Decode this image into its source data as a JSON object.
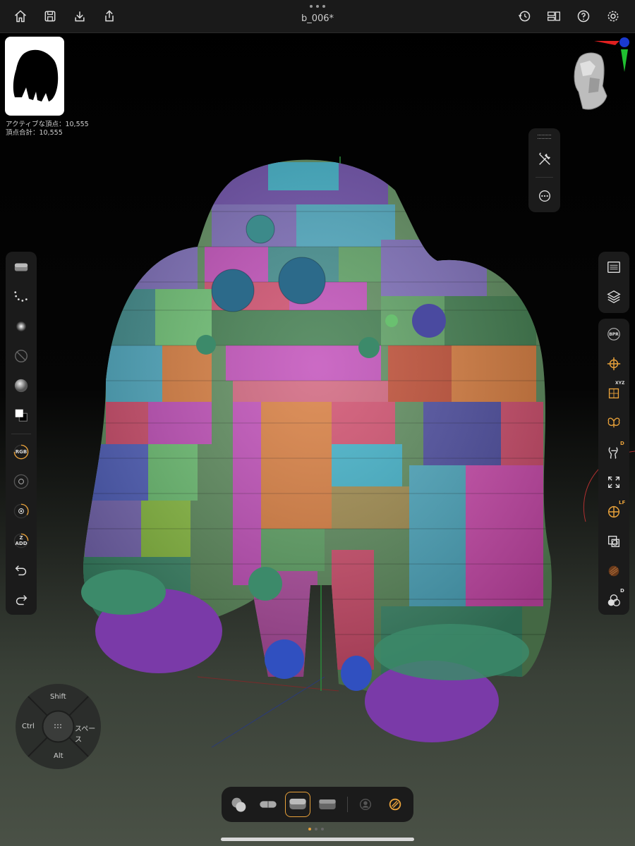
{
  "document": {
    "title": "b_006*"
  },
  "stats": {
    "active_vertices": "アクティブな頂点：10,555",
    "total_vertices": "頂点合計：10,555"
  },
  "left_toolbar": {
    "rgb_label": "RGB",
    "z_label": "Z",
    "add_label": "ADD"
  },
  "right_toolbar": {
    "bpr_label": "BPR",
    "xyz_label": "XYZ",
    "d_label": "D",
    "lf_label": "LF",
    "d2_label": "D"
  },
  "modifier_pad": {
    "shift": "Shift",
    "ctrl": "Ctrl",
    "space": "スペース",
    "alt": "Alt"
  },
  "colors": {
    "accent": "#e8a13a",
    "panel": "#1b1b1b",
    "topbar": "#1a1a1a"
  },
  "pager": {
    "pages": 3,
    "current": 1
  }
}
